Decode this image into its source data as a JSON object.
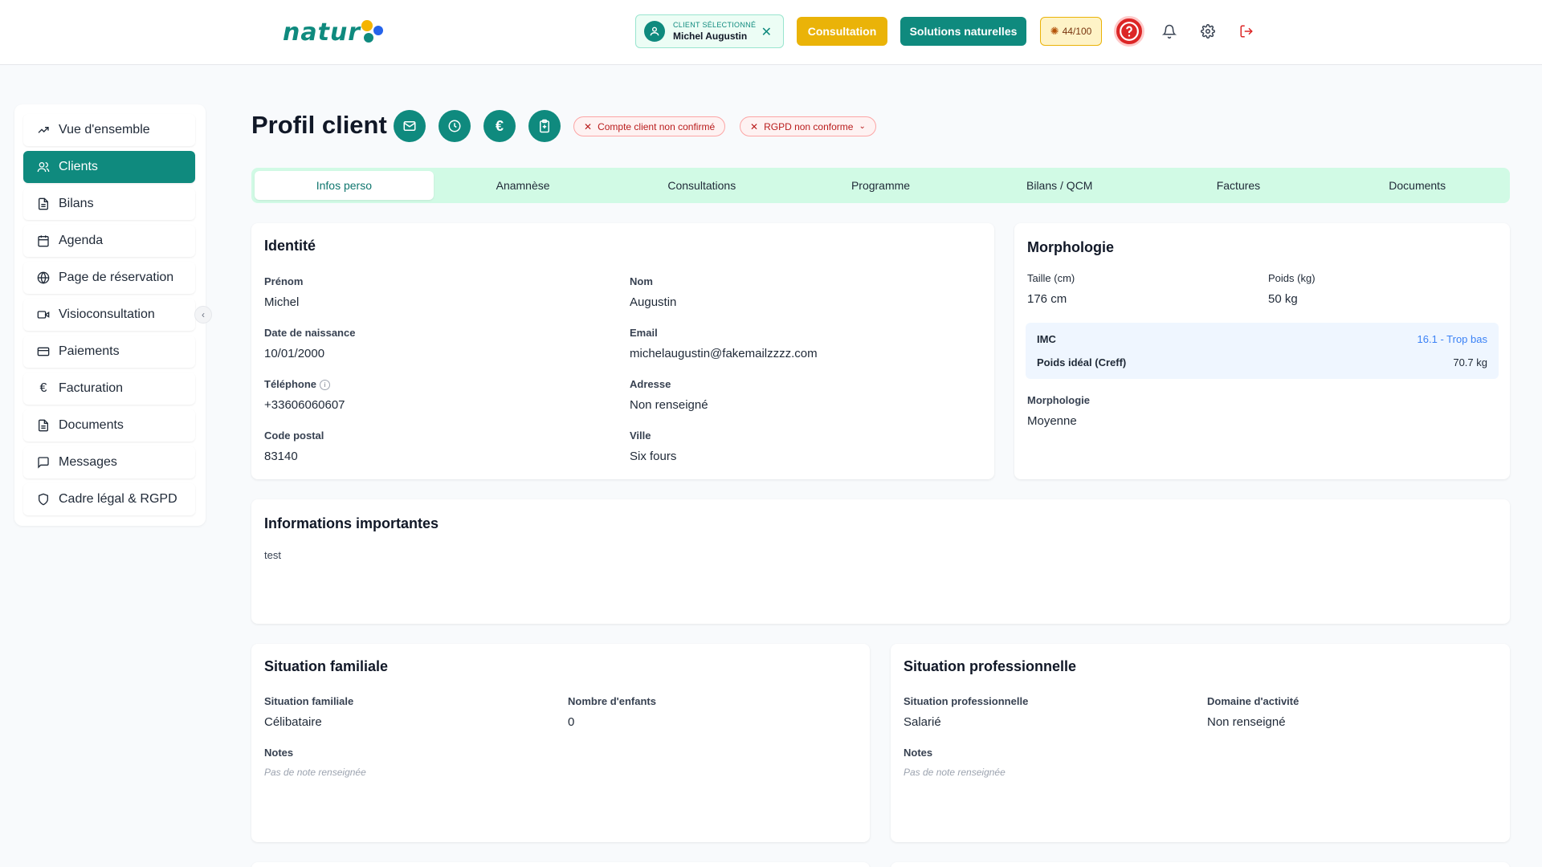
{
  "header": {
    "logo_text": "natur",
    "client_chip": {
      "label": "CLIENT SÉLECTIONNÉ",
      "name": "Michel Augustin"
    },
    "btn_consultation": "Consultation",
    "btn_solutions": "Solutions naturelles",
    "score": "44/100"
  },
  "sidebar": {
    "items": [
      {
        "label": "Vue d'ensemble",
        "icon": "trending-up-icon"
      },
      {
        "label": "Clients",
        "icon": "users-icon"
      },
      {
        "label": "Bilans",
        "icon": "file-text-icon"
      },
      {
        "label": "Agenda",
        "icon": "calendar-icon"
      },
      {
        "label": "Page de réservation",
        "icon": "globe-icon"
      },
      {
        "label": "Visioconsultation",
        "icon": "video-icon"
      },
      {
        "label": "Paiements",
        "icon": "credit-card-icon"
      },
      {
        "label": "Facturation",
        "icon": "euro-icon"
      },
      {
        "label": "Documents",
        "icon": "file-text-icon"
      },
      {
        "label": "Messages",
        "icon": "message-icon"
      },
      {
        "label": "Cadre légal & RGPD",
        "icon": "shield-icon"
      }
    ],
    "active_index": 1
  },
  "page": {
    "title": "Profil client",
    "pills": {
      "account": "Compte client non confirmé",
      "rgpd": "RGPD non conforme"
    }
  },
  "tabs": [
    "Infos perso",
    "Anamnèse",
    "Consultations",
    "Programme",
    "Bilans / QCM",
    "Factures",
    "Documents"
  ],
  "identity": {
    "title": "Identité",
    "prenom_label": "Prénom",
    "prenom": "Michel",
    "nom_label": "Nom",
    "nom": "Augustin",
    "dob_label": "Date de naissance",
    "dob": "10/01/2000",
    "email_label": "Email",
    "email": "michelaugustin@fakemailzzzz.com",
    "tel_label": "Téléphone",
    "tel": "+33606060607",
    "adresse_label": "Adresse",
    "adresse": "Non renseigné",
    "cp_label": "Code postal",
    "cp": "83140",
    "ville_label": "Ville",
    "ville": "Six fours"
  },
  "morphology": {
    "title": "Morphologie",
    "taille_label": "Taille (cm)",
    "taille": "176 cm",
    "poids_label": "Poids (kg)",
    "poids": "50 kg",
    "imc_label": "IMC",
    "imc_value": "16.1 - Trop bas",
    "ideal_label": "Poids idéal (Creff)",
    "ideal_value": "70.7 kg",
    "morpho_label": "Morphologie",
    "morpho_value": "Moyenne",
    "imc_color": "#3b82f6"
  },
  "important": {
    "title": "Informations importantes",
    "text": "test"
  },
  "family": {
    "title": "Situation familiale",
    "situation_label": "Situation familiale",
    "situation": "Célibataire",
    "children_label": "Nombre d'enfants",
    "children": "0",
    "notes_label": "Notes",
    "notes": "Pas de note renseignée"
  },
  "professional": {
    "title": "Situation professionnelle",
    "situation_label": "Situation professionnelle",
    "situation": "Salarié",
    "domain_label": "Domaine d'activité",
    "domain": "Non renseigné",
    "notes_label": "Notes",
    "notes": "Pas de note renseignée"
  },
  "colors": {
    "primary": "#0f8a7e",
    "accent_yellow": "#eab308",
    "danger": "#dc2626",
    "tab_bg": "#d1fae5"
  }
}
